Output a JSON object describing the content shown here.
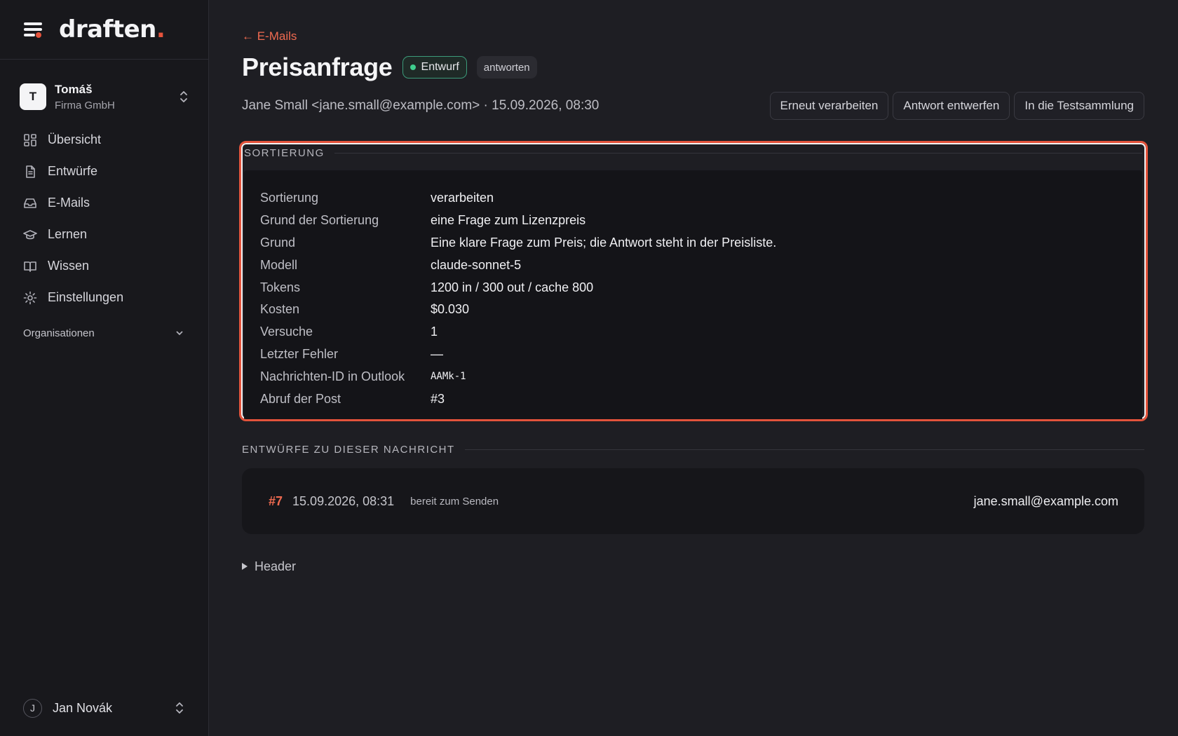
{
  "brand": {
    "logo_text": "draften",
    "logo_dot": "."
  },
  "org": {
    "initial": "T",
    "name": "Tomáš",
    "company": "Firma GmbH"
  },
  "nav": {
    "items": [
      {
        "label": "Übersicht",
        "icon": "grid-icon"
      },
      {
        "label": "Entwürfe",
        "icon": "document-icon"
      },
      {
        "label": "E-Mails",
        "icon": "inbox-icon"
      },
      {
        "label": "Lernen",
        "icon": "graduation-cap-icon"
      },
      {
        "label": "Wissen",
        "icon": "book-icon"
      },
      {
        "label": "Einstellungen",
        "icon": "gear-icon"
      }
    ],
    "group_label": "Organisationen"
  },
  "user": {
    "initial": "J",
    "name": "Jan Novák"
  },
  "page": {
    "back_label": "← E-Mails",
    "title": "Preisanfrage",
    "status_badge": "Entwurf",
    "tag_badge": "antworten",
    "meta": "Jane Small <jane.small@example.com> · 15.09.2026, 08:30",
    "actions": {
      "reprocess": "Erneut verarbeiten",
      "draft_reply": "Antwort entwerfen",
      "test_collection": "In die Testsammlung"
    }
  },
  "sorting": {
    "section_label": "Sortierung",
    "rows": [
      {
        "key": "Sortierung",
        "value": "verarbeiten"
      },
      {
        "key": "Grund der Sortierung",
        "value": "eine Frage zum Lizenzpreis"
      },
      {
        "key": "Grund",
        "value": "Eine klare Frage zum Preis; die Antwort steht in der Preisliste."
      },
      {
        "key": "Modell",
        "value": "claude-sonnet-5"
      },
      {
        "key": "Tokens",
        "value": "1200 in / 300 out / cache 800"
      },
      {
        "key": "Kosten",
        "value": "$0.030"
      },
      {
        "key": "Versuche",
        "value": "1"
      },
      {
        "key": "Letzter Fehler",
        "value": "—"
      },
      {
        "key": "Nachrichten-ID in Outlook",
        "value": "AAMk-1"
      },
      {
        "key": "Abruf der Post",
        "value": "#3"
      }
    ]
  },
  "drafts": {
    "section_label": "Entwürfe zu dieser Nachricht",
    "items": [
      {
        "number": "#7",
        "date": "15.09.2026, 08:31",
        "status": "bereit zum Senden",
        "to": "jane.small@example.com"
      }
    ]
  },
  "header_toggle": {
    "label": "Header"
  },
  "colors": {
    "accent": "#e5533c",
    "success": "#3fcf8e",
    "background": "#1e1e23",
    "sidebar": "#18181c"
  }
}
